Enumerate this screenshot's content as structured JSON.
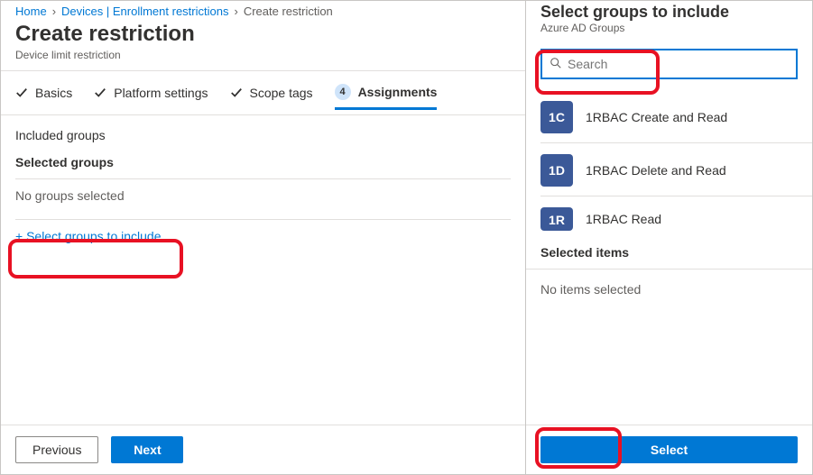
{
  "breadcrumb": {
    "items": [
      "Home",
      "Devices | Enrollment restrictions",
      "Create restriction"
    ]
  },
  "page": {
    "title": "Create restriction",
    "subtitle": "Device limit restriction"
  },
  "wizard": {
    "tabs": [
      {
        "label": "Basics"
      },
      {
        "label": "Platform settings"
      },
      {
        "label": "Scope tags"
      },
      {
        "label": "Assignments",
        "num": "4"
      }
    ]
  },
  "content": {
    "included_label": "Included groups",
    "selected_groups_label": "Selected groups",
    "no_groups": "No groups selected",
    "add_link": "+ Select groups to include"
  },
  "footer": {
    "previous": "Previous",
    "next": "Next"
  },
  "panel": {
    "title": "Select groups to include",
    "subtitle": "Azure AD Groups",
    "search_placeholder": "Search",
    "groups": [
      {
        "initials": "1C",
        "name": "1RBAC Create and Read"
      },
      {
        "initials": "1D",
        "name": "1RBAC Delete and Read"
      },
      {
        "initials": "1R",
        "name": "1RBAC Read"
      }
    ],
    "selected_items_label": "Selected items",
    "no_items": "No items selected",
    "select_button": "Select"
  }
}
